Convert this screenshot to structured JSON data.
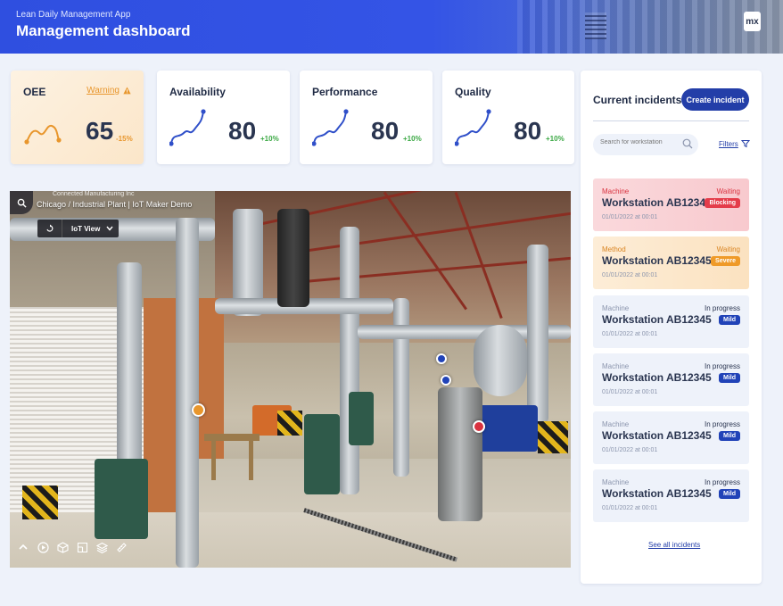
{
  "header": {
    "app_name": "Lean Daily Management App",
    "title": "Management dashboard",
    "logo_text": "mx"
  },
  "kpis": [
    {
      "title": "OEE",
      "value": "65",
      "delta": "-15%",
      "warning": "Warning",
      "trend_color": "#e8962c",
      "trend": "down"
    },
    {
      "title": "Availability",
      "value": "80",
      "delta": "+10%",
      "trend_color": "#2f4fc9",
      "trend": "up"
    },
    {
      "title": "Performance",
      "value": "80",
      "delta": "+10%",
      "trend_color": "#2f4fc9",
      "trend": "up"
    },
    {
      "title": "Quality",
      "value": "80",
      "delta": "+10%",
      "trend_color": "#2f4fc9",
      "trend": "up"
    }
  ],
  "viewer": {
    "breadcrumb_top": "Connected Manufacturing Inc",
    "breadcrumb": "Chicago / Industrial Plant | IoT Maker Demo",
    "view_mode": "IoT View",
    "hotspot_colors": {
      "warning": "#e8962c",
      "ok": "#2143b8",
      "alert": "#d9323f"
    }
  },
  "incidents_panel": {
    "title": "Current incidents",
    "create_label": "Create incident",
    "search_placeholder": "Search for workstation",
    "filters_label": "Filters",
    "see_all_label": "See all incidents",
    "items": [
      {
        "category": "Machine",
        "name": "Workstation AB12345",
        "date": "01/01/2022 at 00:01",
        "status": "Waiting",
        "badge": "Blocking"
      },
      {
        "category": "Method",
        "name": "Workstation AB12345",
        "date": "01/01/2022 at 00:01",
        "status": "Waiting",
        "badge": "Severe"
      },
      {
        "category": "Machine",
        "name": "Workstation AB12345",
        "date": "01/01/2022 at 00:01",
        "status": "In progress",
        "badge": "Mild"
      },
      {
        "category": "Machine",
        "name": "Workstation AB12345",
        "date": "01/01/2022 at 00:01",
        "status": "In progress",
        "badge": "Mild"
      },
      {
        "category": "Machine",
        "name": "Workstation AB12345",
        "date": "01/01/2022 at 00:01",
        "status": "In progress",
        "badge": "Mild"
      },
      {
        "category": "Machine",
        "name": "Workstation AB12345",
        "date": "01/01/2022 at 00:01",
        "status": "In progress",
        "badge": "Mild"
      }
    ]
  },
  "colors": {
    "brand_blue": "#2f4fe0",
    "button_blue": "#233ea8",
    "positive": "#3aa843",
    "warning": "#e8962c",
    "blocking": "#e43c4a",
    "severe": "#ef9a28",
    "mild": "#2143b8"
  }
}
